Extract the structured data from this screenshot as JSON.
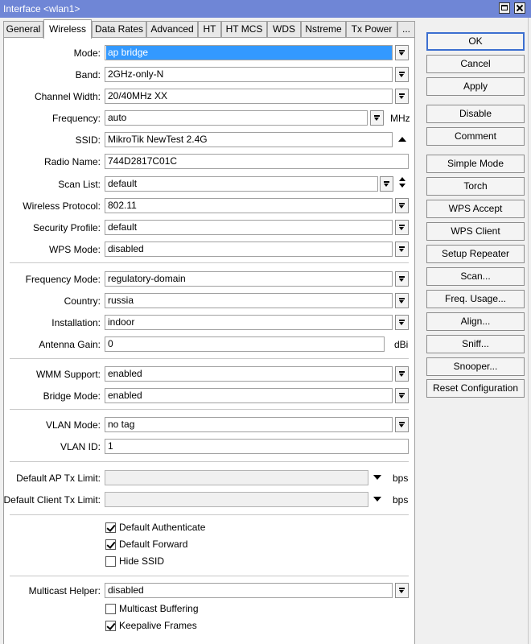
{
  "window": {
    "title": "Interface <wlan1>"
  },
  "tabs": [
    "General",
    "Wireless",
    "Data Rates",
    "Advanced",
    "HT",
    "HT MCS",
    "WDS",
    "Nstreme",
    "Tx Power",
    "..."
  ],
  "form": {
    "mode": {
      "label": "Mode:",
      "value": "ap bridge"
    },
    "band": {
      "label": "Band:",
      "value": "2GHz-only-N"
    },
    "channel_width": {
      "label": "Channel Width:",
      "value": "20/40MHz XX"
    },
    "frequency": {
      "label": "Frequency:",
      "value": "auto",
      "unit": "MHz"
    },
    "ssid": {
      "label": "SSID:",
      "value": "MikroTik NewTest 2.4G"
    },
    "radio_name": {
      "label": "Radio Name:",
      "value": "744D2817C01C"
    },
    "scan_list": {
      "label": "Scan List:",
      "value": "default"
    },
    "wireless_protocol": {
      "label": "Wireless Protocol:",
      "value": "802.11"
    },
    "security_profile": {
      "label": "Security Profile:",
      "value": "default"
    },
    "wps_mode": {
      "label": "WPS Mode:",
      "value": "disabled"
    },
    "frequency_mode": {
      "label": "Frequency Mode:",
      "value": "regulatory-domain"
    },
    "country": {
      "label": "Country:",
      "value": "russia"
    },
    "installation": {
      "label": "Installation:",
      "value": "indoor"
    },
    "antenna_gain": {
      "label": "Antenna Gain:",
      "value": "0",
      "unit": "dBi"
    },
    "wmm_support": {
      "label": "WMM Support:",
      "value": "enabled"
    },
    "bridge_mode": {
      "label": "Bridge Mode:",
      "value": "enabled"
    },
    "vlan_mode": {
      "label": "VLAN Mode:",
      "value": "no tag"
    },
    "vlan_id": {
      "label": "VLAN ID:",
      "value": "1"
    },
    "default_ap_tx_limit": {
      "label": "Default AP Tx Limit:",
      "value": "",
      "unit": "bps"
    },
    "default_client_tx_limit": {
      "label": "Default Client Tx Limit:",
      "value": "",
      "unit": "bps"
    },
    "default_authenticate": {
      "label": "Default Authenticate",
      "checked": true
    },
    "default_forward": {
      "label": "Default Forward",
      "checked": true
    },
    "hide_ssid": {
      "label": "Hide SSID",
      "checked": false
    },
    "multicast_helper": {
      "label": "Multicast Helper:",
      "value": "disabled"
    },
    "multicast_buffering": {
      "label": "Multicast Buffering",
      "checked": false
    },
    "keepalive_frames": {
      "label": "Keepalive Frames",
      "checked": true
    }
  },
  "buttons": {
    "ok": "OK",
    "cancel": "Cancel",
    "apply": "Apply",
    "disable": "Disable",
    "comment": "Comment",
    "simple_mode": "Simple Mode",
    "torch": "Torch",
    "wps_accept": "WPS Accept",
    "wps_client": "WPS Client",
    "setup_repeater": "Setup Repeater",
    "scan": "Scan...",
    "freq_usage": "Freq. Usage...",
    "align": "Align...",
    "sniff": "Sniff...",
    "snooper": "Snooper...",
    "reset_configuration": "Reset Configuration"
  },
  "colors": {
    "titlebar": "#6f86d6",
    "selection": "#3399ff",
    "default_button_border": "#3c6fd0"
  }
}
